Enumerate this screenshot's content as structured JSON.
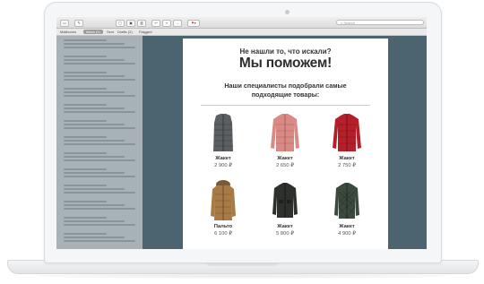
{
  "mail_toolbar": {
    "search_placeholder": "Search",
    "favorites": [
      "Mailboxes",
      "Inbox (1)",
      "Sent",
      "Drafts (2)",
      "Flagged"
    ]
  },
  "email": {
    "question": "Не нашли то, что искали?",
    "headline": "Мы поможем!",
    "subheading": "Наши специалисты подобрали самые подходящие товары:",
    "products": [
      {
        "name": "Жакет",
        "price": "2 900 ₽",
        "image": "grey-puffer-vest",
        "color": "#5c5f62"
      },
      {
        "name": "Жакет",
        "price": "2 650 ₽",
        "image": "pink-down-jacket",
        "color": "#d98a84"
      },
      {
        "name": "Жакет",
        "price": "2 750 ₽",
        "image": "red-down-jacket",
        "color": "#b51f2a"
      },
      {
        "name": "Пальто",
        "price": "6 100 ₽",
        "image": "brown-parka",
        "color": "#a87a45"
      },
      {
        "name": "Жакет",
        "price": "5 800 ₽",
        "image": "black-field-jacket",
        "color": "#2e302e"
      },
      {
        "name": "Жакет",
        "price": "4 900 ₽",
        "image": "green-quilted-jacket",
        "color": "#3c4a3e"
      }
    ]
  }
}
